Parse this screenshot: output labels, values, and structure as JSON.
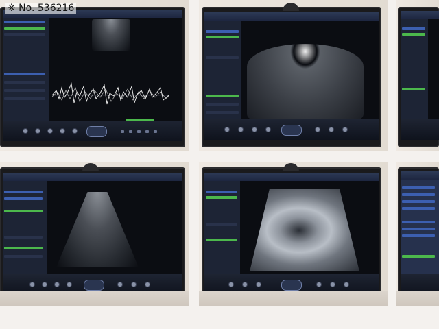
{
  "watermark": "※ No. 536216",
  "panels": [
    {
      "name": "doppler-spectrum-screen",
      "mode": "spectral"
    },
    {
      "name": "endocavity-probe-screen",
      "mode": "radial"
    },
    {
      "name": "edge-right-top",
      "mode": "edge"
    },
    {
      "name": "convex-probe-screen",
      "mode": "convex"
    },
    {
      "name": "abdominal-image-screen",
      "mode": "tissue"
    },
    {
      "name": "edge-right-bottom",
      "mode": "edge"
    }
  ],
  "colors": {
    "accent_green": "#4cb84c",
    "menu_blue": "#3c5fb0",
    "screen_dark": "#0b0d12",
    "bezel": "#1a1a1c"
  }
}
